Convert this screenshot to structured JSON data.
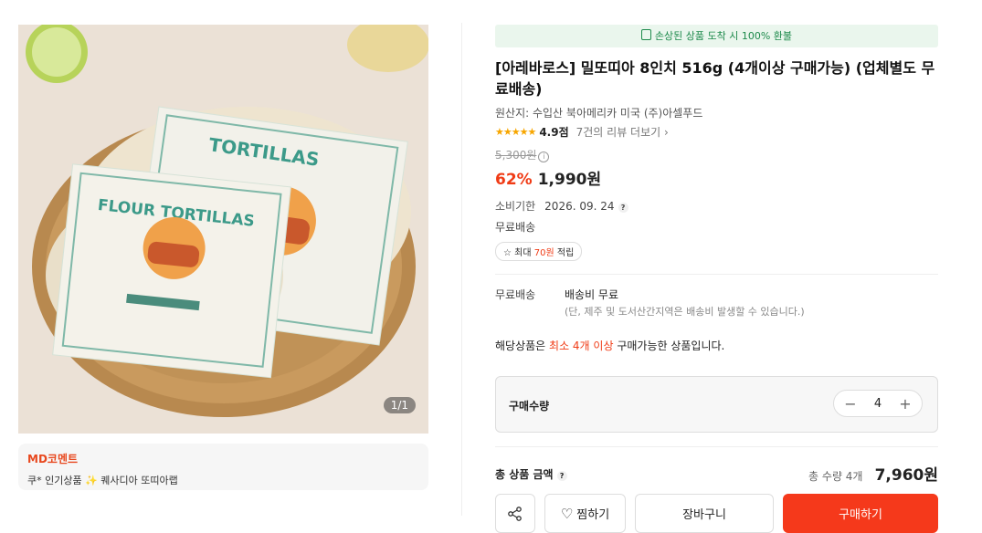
{
  "gallery": {
    "counter": "1/1",
    "pkg_text_1": "FLOUR TORTILLAS",
    "pkg_text_2": "TORTILLAS"
  },
  "md": {
    "title": "MD코멘트",
    "text": "쿠* 인기상품 ✨ 퀘사디아 또띠아랩"
  },
  "banner": {
    "text": "손상된 상품 도착 시 100% 환불",
    "color": "#1e8a4c"
  },
  "product": {
    "title": "[아레바로스] 밀또띠아 8인치 516g (4개이상 구매가능) (업체별도 무료배송)",
    "origin": "원산지: 수입산 북아메리카 미국 (주)아셀푸드",
    "stars": "★★★★★",
    "score": "4.9점",
    "review_link": "7건의 리뷰 더보기 ›",
    "original_price": "5,300원",
    "discount": "62%",
    "price": "1,990원",
    "expiry_label": "소비기한",
    "expiry_value": "2026. 09. 24",
    "free_ship": "무료배송",
    "points_prefix": "최대",
    "points_value": "70원",
    "points_suffix": "적립"
  },
  "shipping": {
    "label": "무료배송",
    "main": "배송비 무료",
    "sub": "(단, 제주 및 도서산간지역은 배송비 발생할 수 있습니다.)"
  },
  "notice": {
    "prefix": "해당상품은",
    "highlight": "최소 4개 이상",
    "suffix": "구매가능한 상품입니다."
  },
  "quantity": {
    "label": "구매수량",
    "value": "4",
    "minus": "−",
    "plus": "+"
  },
  "total": {
    "label": "총 상품 금액",
    "count": "총 수량 4개",
    "amount": "7,960원"
  },
  "actions": {
    "wish": "찜하기",
    "cart": "장바구니",
    "buy": "구매하기"
  },
  "colors": {
    "accent": "#f5391b",
    "discount": "#f03b15",
    "star": "#f7a600"
  }
}
